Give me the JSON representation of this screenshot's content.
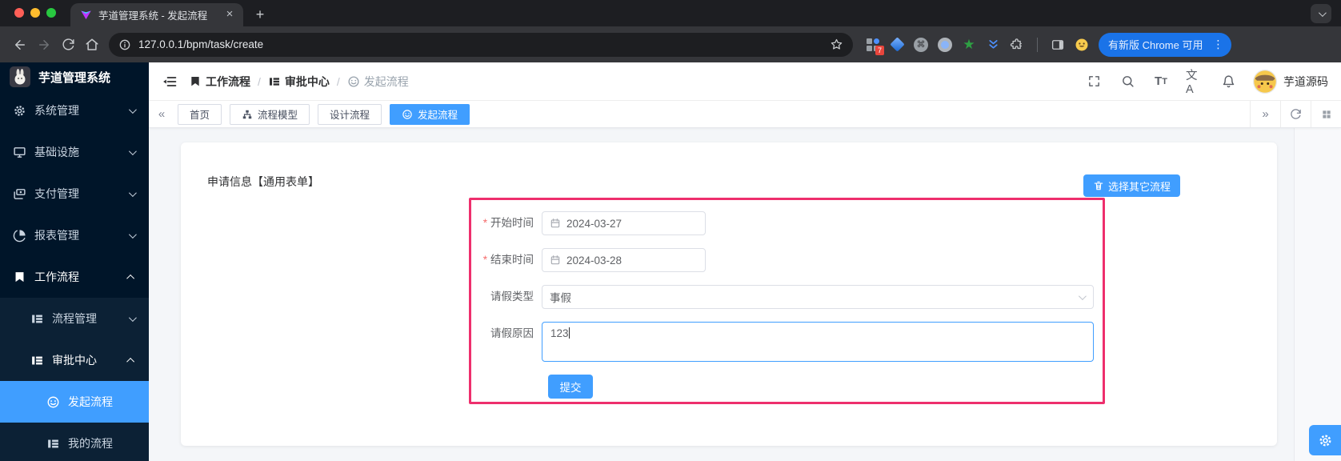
{
  "browser": {
    "tab_title": "芋道管理系统 - 发起流程",
    "url": "127.0.0.1/bpm/task/create",
    "update_label": "有新版 Chrome 可用",
    "extension_badge": "7",
    "glyphs": {
      "close": "×",
      "new_tab": "+",
      "command": "⌘",
      "green_star": "★",
      "kebab": "⋮"
    }
  },
  "sidebar": {
    "app_title": "芋道管理系统",
    "menu": [
      {
        "label": "系统管理"
      },
      {
        "label": "基础设施"
      },
      {
        "label": "支付管理"
      },
      {
        "label": "报表管理"
      },
      {
        "label": "工作流程"
      },
      {
        "label": "流程管理"
      },
      {
        "label": "审批中心"
      },
      {
        "label": "发起流程"
      },
      {
        "label": "我的流程"
      }
    ]
  },
  "navbar": {
    "breadcrumb": [
      {
        "label": "工作流程"
      },
      {
        "label": "审批中心"
      },
      {
        "label": "发起流程"
      }
    ],
    "separator": "/",
    "font_size_large": "T",
    "font_size_small": "T",
    "language_icon_text": "文A",
    "username": "芋道源码"
  },
  "tagsbar": {
    "collapse_left": "«",
    "expand_right": "»",
    "tabs": [
      {
        "label": "首页"
      },
      {
        "label": "流程模型"
      },
      {
        "label": "设计流程"
      },
      {
        "label": "发起流程"
      }
    ]
  },
  "content": {
    "card_title": "申请信息【通用表单】",
    "choose_process_label": "选择其它流程",
    "form": {
      "fields": [
        {
          "label": "开始时间",
          "value": "2024-03-27",
          "required": true,
          "type": "date"
        },
        {
          "label": "结束时间",
          "value": "2024-03-28",
          "required": true,
          "type": "date"
        },
        {
          "label": "请假类型",
          "value": "事假",
          "required": false,
          "type": "select"
        },
        {
          "label": "请假原因",
          "value": "123",
          "required": false,
          "type": "textarea"
        }
      ],
      "submit_label": "提交"
    }
  },
  "colors": {
    "primary": "#409eff",
    "annotation_box": "#ee2f6d",
    "sidebar_bg": "#001529",
    "chrome_update_pill": "#1a73e8"
  }
}
